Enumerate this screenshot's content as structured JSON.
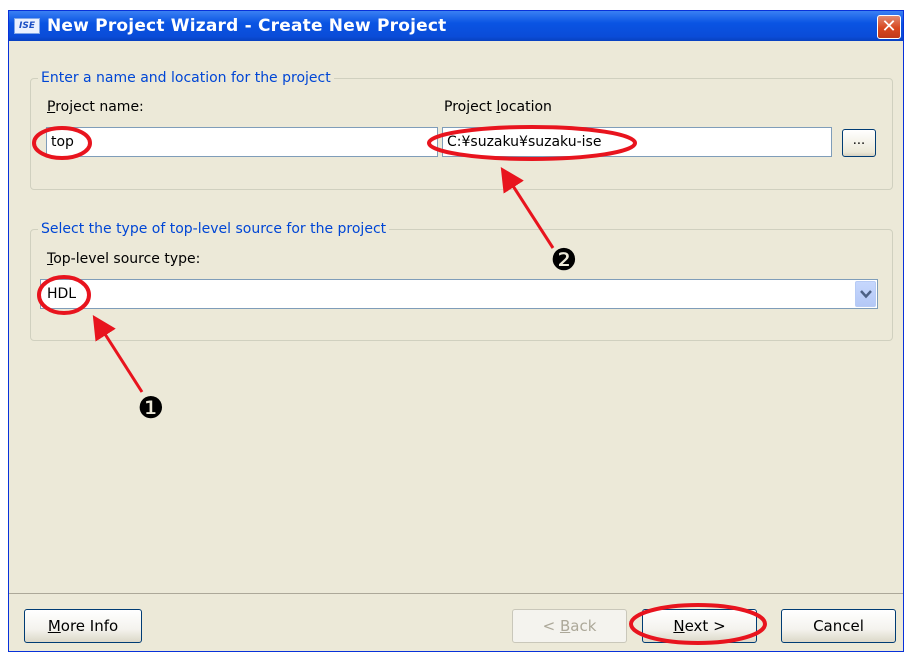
{
  "window": {
    "title": "New Project Wizard - Create New Project",
    "app_icon_text": "ISE"
  },
  "group_name_location": {
    "legend": "Enter a name and location for the project",
    "project_name_label": "Project name:",
    "project_name_value": "top",
    "project_location_label": "Project location",
    "project_location_value": "C:¥suzaku¥suzaku-ise",
    "browse_label": "..."
  },
  "group_source_type": {
    "legend": "Select the type of top-level source for the project",
    "source_type_label": "Top-level source type:",
    "source_type_value": "HDL"
  },
  "buttons": {
    "more_info": "More Info",
    "back": "< Back",
    "next": "Next >",
    "cancel": "Cancel"
  },
  "annotations": {
    "marker_1": "❶",
    "marker_2": "❷",
    "highlight_color": "#e8141e",
    "marker_color": "#000000"
  },
  "colors": {
    "title_bar": "#0a54e3",
    "legend_text": "#0046d5",
    "dialog_bg": "#ece9d8"
  }
}
